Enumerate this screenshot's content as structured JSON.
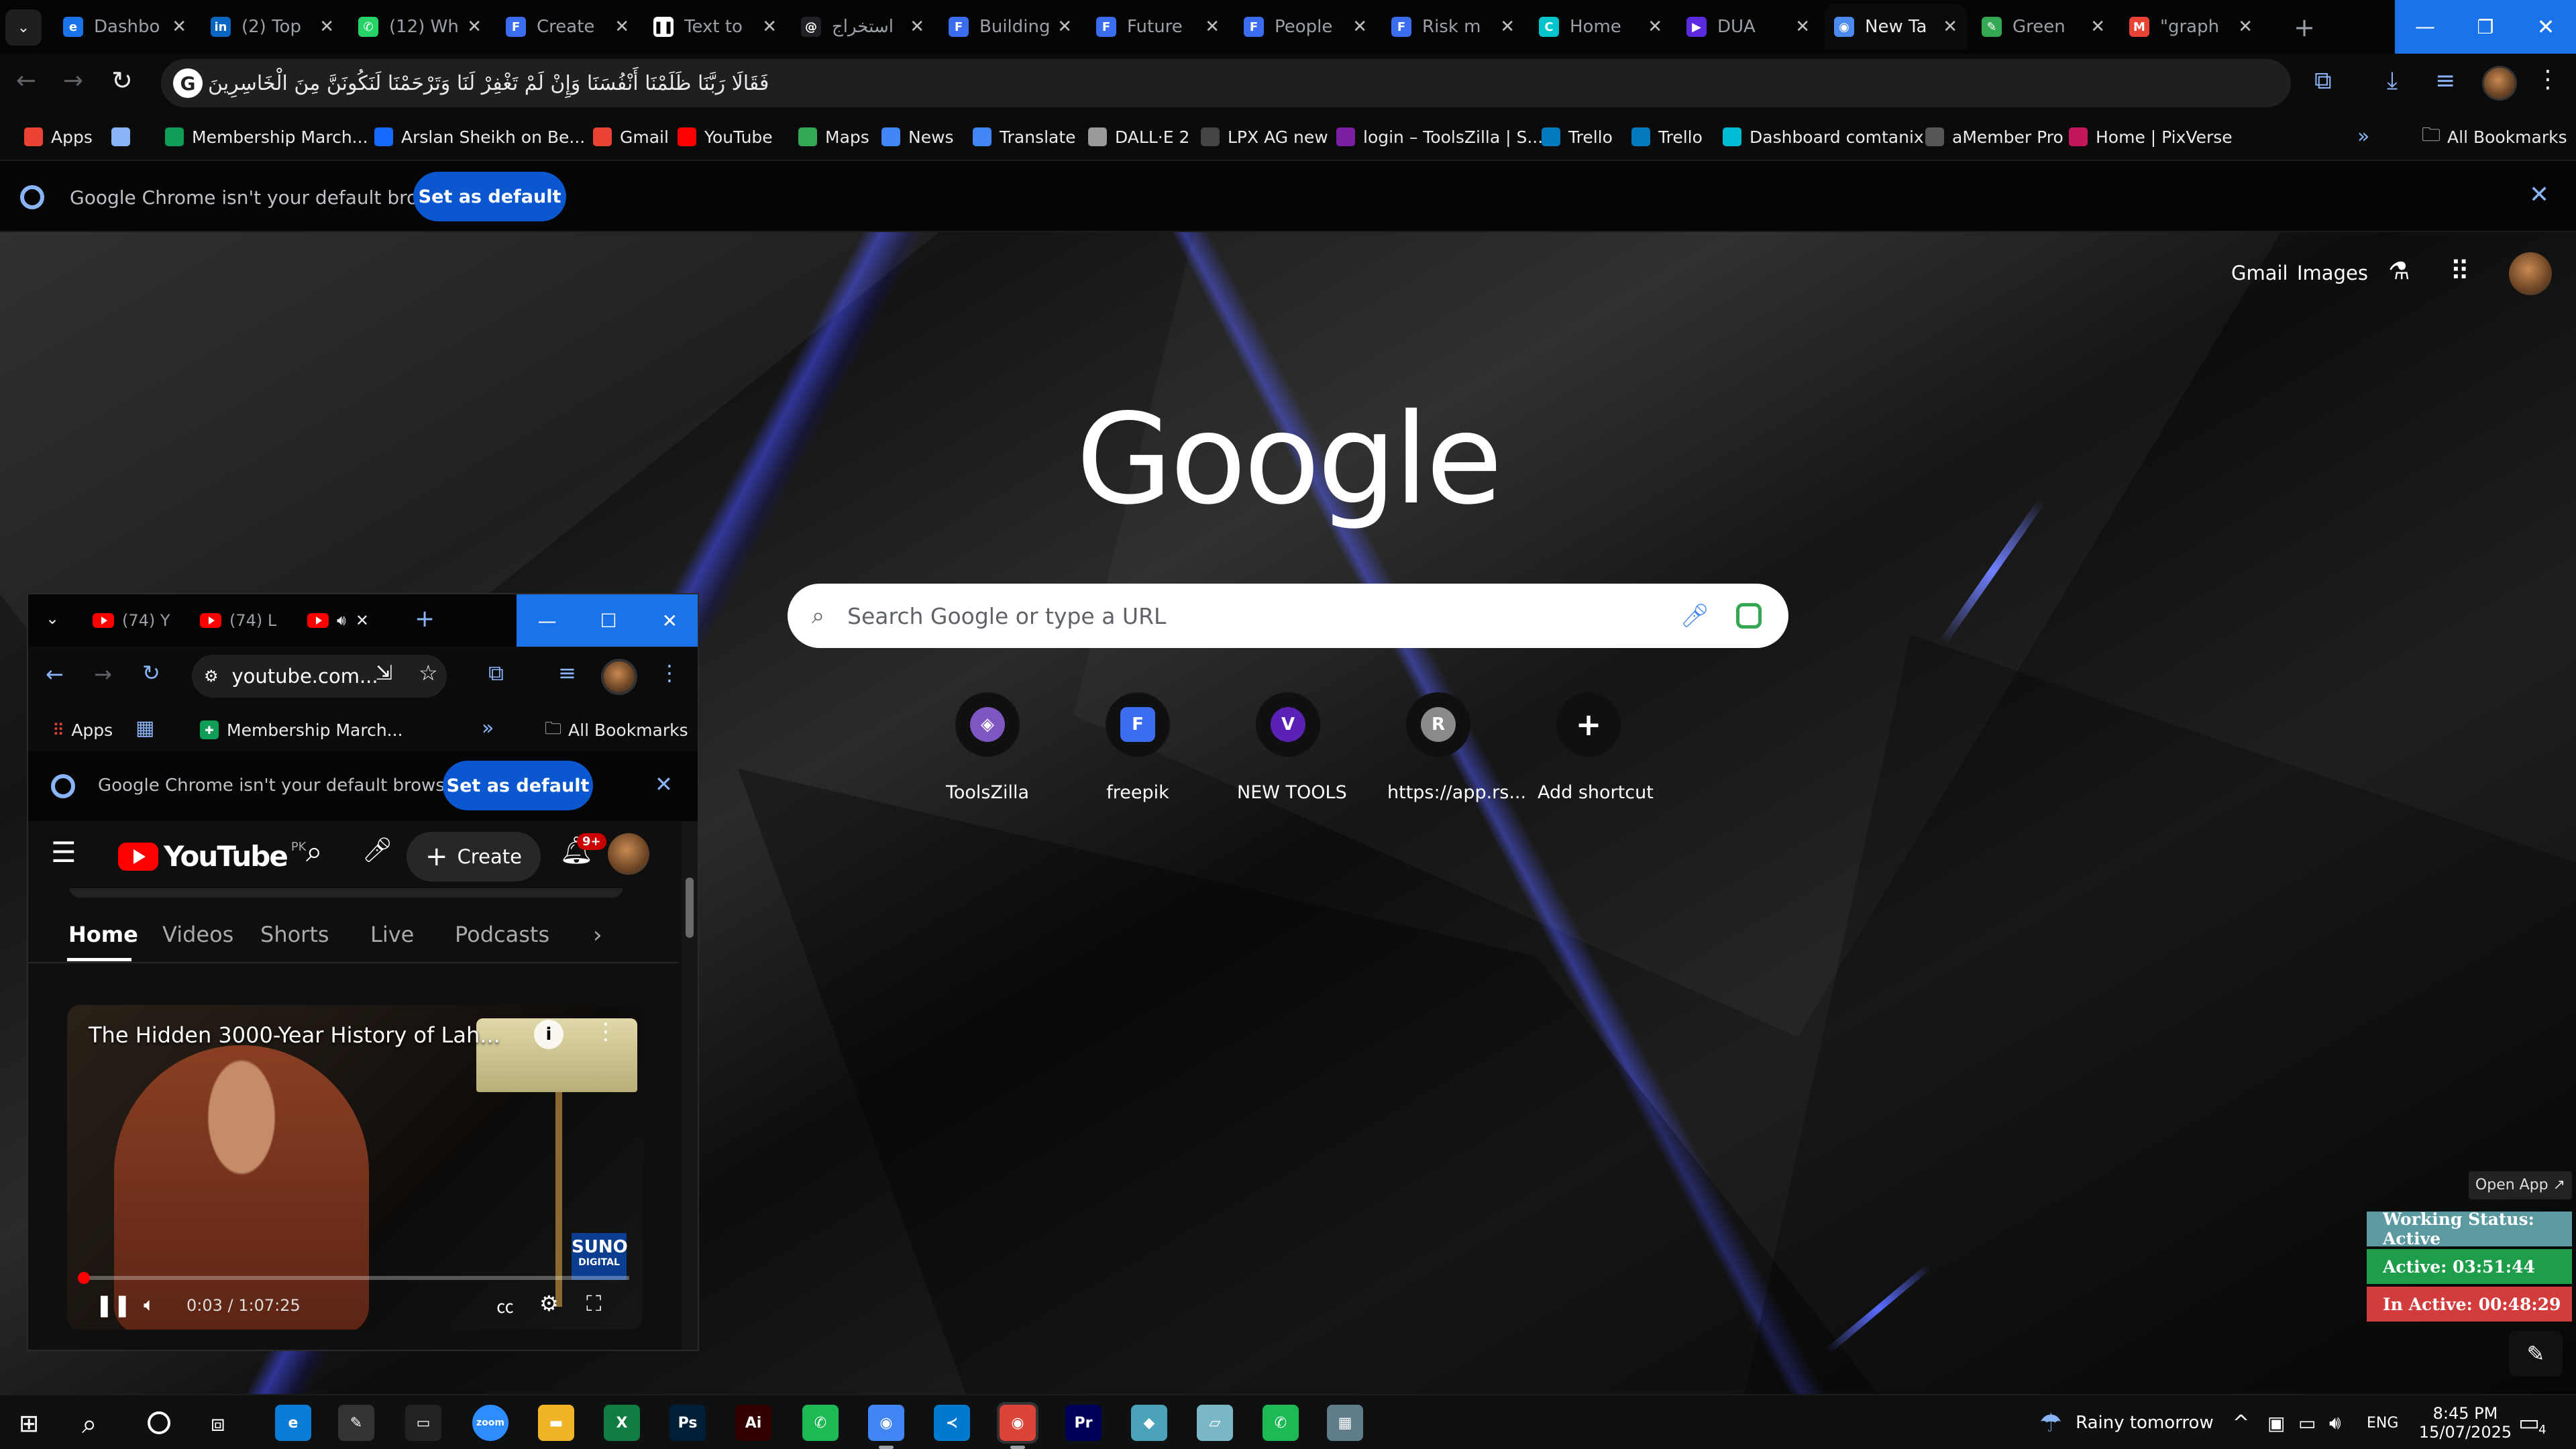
{
  "tabs": [
    {
      "title": "Dashbo",
      "icon": "elementor-icon",
      "color": "#1a73e8",
      "glyph": "e"
    },
    {
      "title": "(2) Top",
      "icon": "linkedin-icon",
      "color": "#0a66c2",
      "glyph": "in"
    },
    {
      "title": "(12) Wh",
      "icon": "whatsapp-icon",
      "color": "#25d366",
      "glyph": "✆"
    },
    {
      "title": "Create",
      "icon": "doc-icon",
      "color": "#3c6df0",
      "glyph": "F"
    },
    {
      "title": "Text to",
      "icon": "pause-icon",
      "color": "#ffffff",
      "glyph": "❚❚"
    },
    {
      "title": "استخراج",
      "icon": "threads-icon",
      "color": "#202124",
      "glyph": "@"
    },
    {
      "title": "Building",
      "icon": "doc-icon",
      "color": "#3c6df0",
      "glyph": "F"
    },
    {
      "title": "Future",
      "icon": "doc-icon",
      "color": "#3c6df0",
      "glyph": "F"
    },
    {
      "title": "People",
      "icon": "doc-icon",
      "color": "#3c6df0",
      "glyph": "F"
    },
    {
      "title": "Risk m",
      "icon": "doc-icon",
      "color": "#3c6df0",
      "glyph": "F"
    },
    {
      "title": "Home",
      "icon": "canva-icon",
      "color": "#00c4cc",
      "glyph": "C"
    },
    {
      "title": "DUA",
      "icon": "video-icon",
      "color": "#5b2be0",
      "glyph": "▶"
    },
    {
      "title": "New Ta",
      "icon": "chrome-icon",
      "color": "#4d8af0",
      "glyph": "◉"
    },
    {
      "title": "Green",
      "icon": "leaf-icon",
      "color": "#34a853",
      "glyph": "✎"
    },
    {
      "title": "\"graph",
      "icon": "gmail-icon",
      "color": "#ea4335",
      "glyph": "M"
    }
  ],
  "omnibox": {
    "text": "فَقَالَا رَبَّنَا ظَلَمْنَا أَنْفُسَنَا وَإِنْ لَمْ تَغْفِرْ لَنَا وَتَرْحَمْنَا لَنَكُونَنَّ مِنَ الْخَاسِرِينَ"
  },
  "bookmarks": [
    {
      "label": "Apps",
      "color": "#ea4335"
    },
    {
      "label": "",
      "color": "#8ab4f8"
    },
    {
      "label": "Membership March...",
      "color": "#0f9d58"
    },
    {
      "label": "Arslan Sheikh on Be...",
      "color": "#1769ff"
    },
    {
      "label": "Gmail",
      "color": "#ea4335"
    },
    {
      "label": "YouTube",
      "color": "#ff0000"
    },
    {
      "label": "Maps",
      "color": "#34a853"
    },
    {
      "label": "News",
      "color": "#4285f4"
    },
    {
      "label": "Translate",
      "color": "#4285f4"
    },
    {
      "label": "DALL·E 2",
      "color": "#999999"
    },
    {
      "label": "LPX AG new",
      "color": "#444444"
    },
    {
      "label": "login – ToolsZilla | S...",
      "color": "#7b1fa2"
    },
    {
      "label": "Trello",
      "color": "#0079bf"
    },
    {
      "label": "Trello",
      "color": "#0079bf"
    },
    {
      "label": "Dashboard comtanix",
      "color": "#00bcd4"
    },
    {
      "label": "aMember Pro",
      "color": "#555555"
    },
    {
      "label": "Home | PixVerse",
      "color": "#c2185b"
    }
  ],
  "all_bookmarks": "All Bookmarks",
  "infobar": {
    "message": "Google Chrome isn't your default browser",
    "button": "Set as default"
  },
  "ntp": {
    "links": {
      "gmail": "Gmail",
      "images": "Images"
    },
    "logo": "Google",
    "search_placeholder": "Search Google or type a URL",
    "shortcuts": [
      {
        "label": "ToolsZilla",
        "glyph": "◈",
        "color": "#7e57c2"
      },
      {
        "label": "freepik",
        "glyph": "F",
        "color": "#3c6df0"
      },
      {
        "label": "NEW TOOLS",
        "glyph": "V",
        "color": "#5b21b6"
      },
      {
        "label": "https://app.rs...",
        "glyph": "R",
        "color": "#8a8a8a"
      },
      {
        "label": "Add shortcut",
        "glyph": "+",
        "color": "#101010"
      }
    ]
  },
  "mini": {
    "tabs": [
      "(74) Y",
      "(74) L",
      ""
    ],
    "url": "youtube.com...",
    "bookmarks": {
      "apps": "Apps",
      "membership": "Membership March...",
      "all": "All Bookmarks"
    },
    "infobar": {
      "message": "Google Chrome isn't your default browser",
      "button": "Set as default"
    },
    "yt": {
      "logo": "YouTube",
      "region": "PK",
      "create": "Create",
      "notif": "9+",
      "chips": [
        "Home",
        "Videos",
        "Shorts",
        "Live",
        "Podcasts"
      ],
      "video_title": "The Hidden 3000-Year History of Lah...",
      "time": "0:03 / 1:07:25",
      "badge_top": "SUNO",
      "badge_bottom": "DIGITAL"
    }
  },
  "widget": {
    "open_app": "Open App ↗",
    "status": "Working Status: Active",
    "active": "Active: 03:51:44",
    "inactive": "In Active: 00:48:29",
    "colors": {
      "status": "#5b9aa0",
      "active": "#1e9e4a",
      "inactive": "#d23c3c"
    }
  },
  "taskbar": {
    "weather": "Rainy tomorrow",
    "lang": "ENG",
    "time": "8:45 PM",
    "date": "15/07/2025",
    "notif": "4",
    "apps": [
      {
        "name": "edge-icon",
        "glyph": "e",
        "color": "#0a7cd6"
      },
      {
        "name": "pen-icon",
        "glyph": "✎",
        "color": "#333333"
      },
      {
        "name": "terminal-icon",
        "glyph": "▭",
        "color": "#222222"
      },
      {
        "name": "zoom-icon",
        "glyph": "zoom",
        "color": "#2d8cff"
      },
      {
        "name": "explorer-icon",
        "glyph": "▬",
        "color": "#f0b429"
      },
      {
        "name": "excel-icon",
        "glyph": "X",
        "color": "#107c41"
      },
      {
        "name": "photoshop-icon",
        "glyph": "Ps",
        "color": "#001e36"
      },
      {
        "name": "illustrator-icon",
        "glyph": "Ai",
        "color": "#330000"
      },
      {
        "name": "phone-icon",
        "glyph": "✆",
        "color": "#1db954"
      },
      {
        "name": "chrome-icon",
        "glyph": "◉",
        "color": "#4285f4"
      },
      {
        "name": "vscode-icon",
        "glyph": "≺",
        "color": "#007acc"
      },
      {
        "name": "chrome-profile-icon",
        "glyph": "◉",
        "color": "#db4437"
      },
      {
        "name": "premiere-icon",
        "glyph": "Pr",
        "color": "#00005b"
      },
      {
        "name": "app-icon",
        "glyph": "◆",
        "color": "#4aa3b8"
      },
      {
        "name": "notes-icon",
        "glyph": "▱",
        "color": "#7ab8c8"
      },
      {
        "name": "phone-icon-2",
        "glyph": "✆",
        "color": "#1db954"
      },
      {
        "name": "calculator-icon",
        "glyph": "▦",
        "color": "#607d8b"
      }
    ]
  }
}
